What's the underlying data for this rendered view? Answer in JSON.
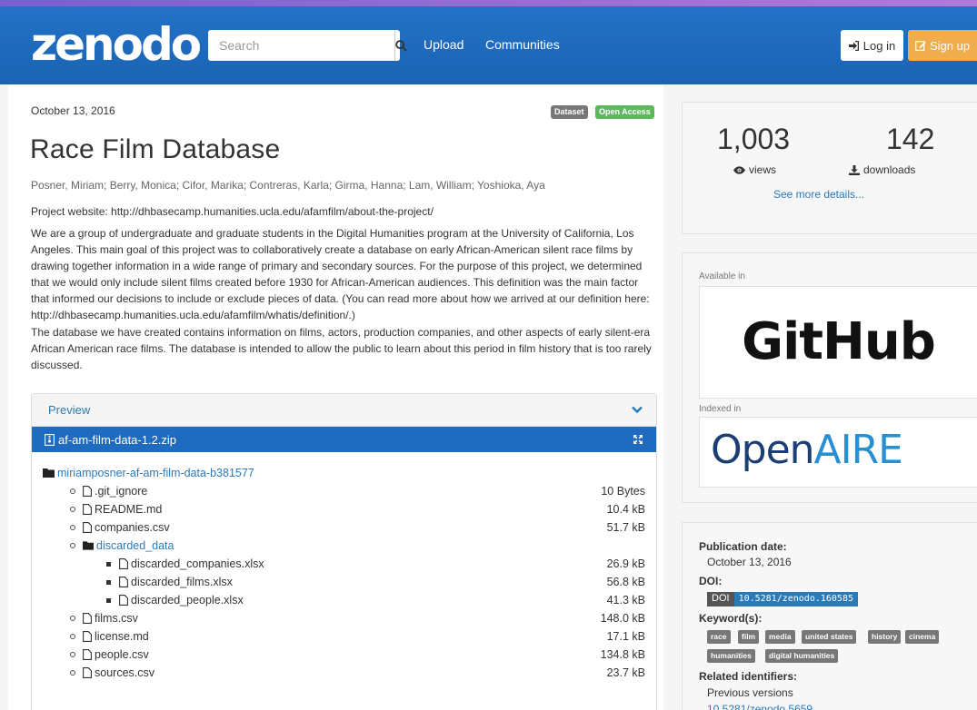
{
  "header": {
    "logo": "zenodo",
    "search_placeholder": "Search",
    "upload": "Upload",
    "communities": "Communities",
    "login": "Log in",
    "signup": "Sign up"
  },
  "record": {
    "date": "October 13, 2016",
    "badge_type": "Dataset",
    "badge_access": "Open Access",
    "title": "Race Film Database",
    "authors": "Posner, Miriam; Berry, Monica; Cifor, Marika; Contreras, Karla; Girma, Hanna; Lam, William; Yoshioka, Aya",
    "website": "Project website: http://dhbasecamp.humanities.ucla.edu/afamfilm/about-the-project/",
    "para1": "We are a group of undergraduate and graduate students in the Digital Humanities program at the University of California, Los Angeles. This main goal of this project was to collaboratively create a database on early African-American silent race films by drawing together information in a wide range of primary and secondary sources. For the purpose of this project, we determined that we would only include silent films created before 1930 for African-American audiences. This definition was the main factor that informed our decisions to include or exclude pieces of data. (You can read more about how we arrived at our definition here: http://dhbasecamp.humanities.ucla.edu/afamfilm/whatis/definition/.)",
    "para2": "The database we have created contains information on films, actors, production companies, and other aspects of early silent-era African American race films. The database is intended to allow the public to learn about this period in film history that is too rarely discussed."
  },
  "preview": {
    "label": "Preview",
    "file": "af-am-film-data-1.2.zip",
    "root": "miriamposner-af-am-film-data-b381577",
    "items": [
      {
        "name": ".git_ignore",
        "size": "10 Bytes"
      },
      {
        "name": "README.md",
        "size": "10.4 kB"
      },
      {
        "name": "companies.csv",
        "size": "51.7 kB"
      },
      {
        "name": "discarded_data",
        "size": ""
      },
      {
        "name": "discarded_companies.xlsx",
        "size": "26.9 kB"
      },
      {
        "name": "discarded_films.xlsx",
        "size": "56.8 kB"
      },
      {
        "name": "discarded_people.xlsx",
        "size": "41.3 kB"
      },
      {
        "name": "films.csv",
        "size": "148.0 kB"
      },
      {
        "name": "license.md",
        "size": "17.1 kB"
      },
      {
        "name": "people.csv",
        "size": "134.8 kB"
      },
      {
        "name": "sources.csv",
        "size": "23.7 kB"
      }
    ]
  },
  "stats": {
    "views": "1,003",
    "views_label": "views",
    "downloads": "142",
    "downloads_label": "downloads",
    "more": "See more details..."
  },
  "sidebar": {
    "available_in": "Available in",
    "github": "GitHub",
    "indexed_in": "Indexed in",
    "openaire_a": "Open",
    "openaire_b": "AIRE",
    "pub_date_label": "Publication date:",
    "pub_date": "October 13, 2016",
    "doi_label": "DOI:",
    "doi_key": "DOI",
    "doi_value": "10.5281/zenodo.160585",
    "keywords_label": "Keyword(s):",
    "keywords": [
      "race",
      "film",
      "media",
      "united states",
      "history",
      "cinema",
      "humanities",
      "digital humanities"
    ],
    "related_label": "Related identifiers:",
    "previous_versions": "Previous versions",
    "related_value": "10.5281/zenodo.5659"
  },
  "colors": {
    "navbar": "#1f6bbf",
    "signup": "#f0ad4e",
    "open_access": "#5cb85c",
    "link": "#2a7ab8"
  }
}
